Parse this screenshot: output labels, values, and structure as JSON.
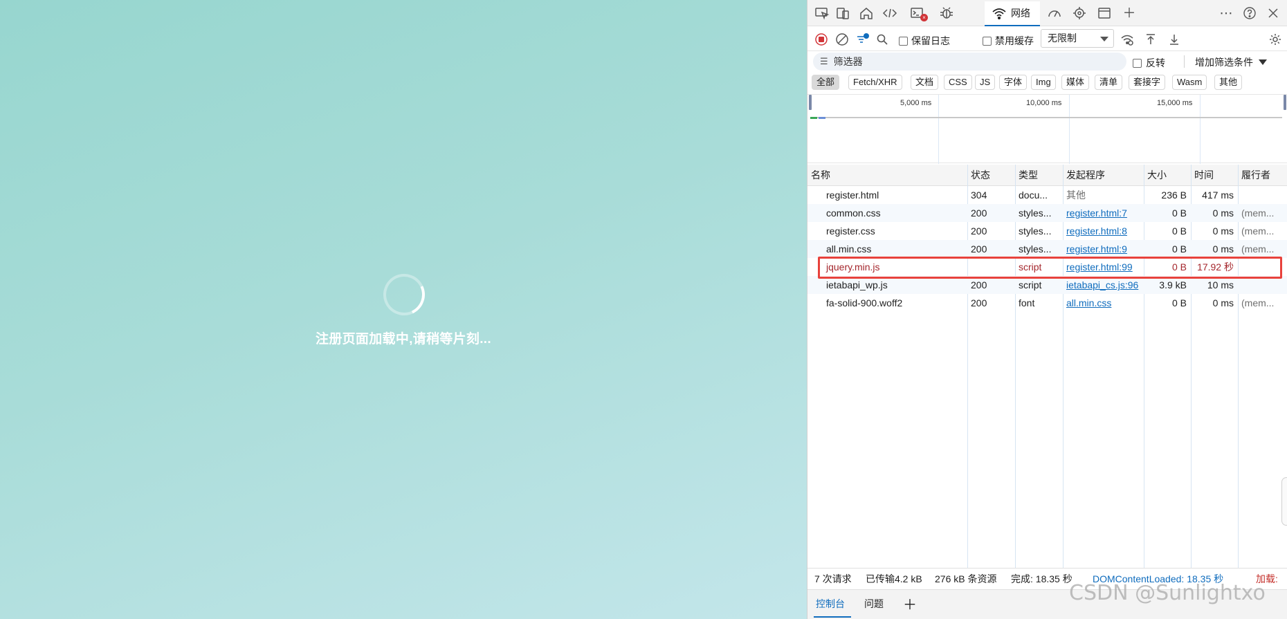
{
  "page": {
    "loading_text": "注册页面加载中,请稍等片刻..."
  },
  "devtools": {
    "tabs": {
      "network": "网络"
    },
    "toolbar": {
      "preserve_log": "保留日志",
      "disable_cache": "禁用缓存",
      "throttling": "无限制"
    },
    "filter": {
      "placeholder": "筛选器",
      "invert": "反转",
      "more_filters": "增加筛选条件"
    },
    "types": [
      "全部",
      "Fetch/XHR",
      "文档",
      "CSS",
      "JS",
      "字体",
      "Img",
      "媒体",
      "清单",
      "套接字",
      "Wasm",
      "其他"
    ],
    "timeline": {
      "ticks": [
        "5,000 ms",
        "10,000 ms",
        "15,000 ms"
      ]
    },
    "columns": [
      "名称",
      "状态",
      "类型",
      "发起程序",
      "大小",
      "时间",
      "履行者"
    ],
    "rows": [
      {
        "name": "register.html",
        "status": "304",
        "type": "docu...",
        "initiator": "其他",
        "size": "236 B",
        "time": "417 ms",
        "fulfilled": ""
      },
      {
        "name": "common.css",
        "status": "200",
        "type": "styles...",
        "initiator": "register.html:7",
        "size": "0 B",
        "time": "0 ms",
        "fulfilled": "(mem..."
      },
      {
        "name": "register.css",
        "status": "200",
        "type": "styles...",
        "initiator": "register.html:8",
        "size": "0 B",
        "time": "0 ms",
        "fulfilled": "(mem..."
      },
      {
        "name": "all.min.css",
        "status": "200",
        "type": "styles...",
        "initiator": "register.html:9",
        "size": "0 B",
        "time": "0 ms",
        "fulfilled": "(mem..."
      },
      {
        "name": "jquery.min.js",
        "status": "",
        "type": "script",
        "initiator": "register.html:99",
        "size": "0 B",
        "time": "17.92 秒",
        "fulfilled": ""
      },
      {
        "name": "ietabapi_wp.js",
        "status": "200",
        "type": "script",
        "initiator": "ietabapi_cs.js:96",
        "size": "3.9 kB",
        "time": "10 ms",
        "fulfilled": ""
      },
      {
        "name": "fa-solid-900.woff2",
        "status": "200",
        "type": "font",
        "initiator": "all.min.css",
        "size": "0 B",
        "time": "0 ms",
        "fulfilled": "(mem..."
      }
    ],
    "summary": {
      "requests": "7 次请求",
      "transferred": "已传输4.2 kB",
      "resources": "276 kB 条资源",
      "finish": "完成: 18.35 秒",
      "dcl": "DOMContentLoaded: 18.35 秒",
      "load": "加载:"
    },
    "drawer": {
      "console": "控制台",
      "issues": "问题"
    }
  },
  "watermark": "CSDN @Sunlightxo",
  "colors": {
    "accent": "#0f6cbd",
    "error": "#a4262c",
    "highlight": "#e8423c",
    "page_bg_start": "#97d6cf",
    "page_bg_end": "#c3e6ea"
  }
}
